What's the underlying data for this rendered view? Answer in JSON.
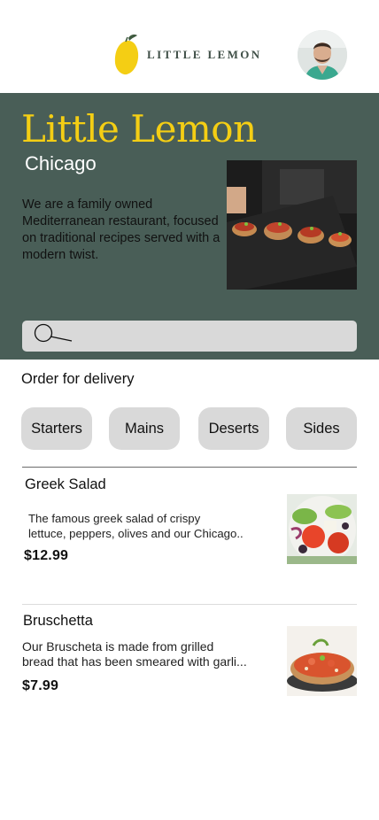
{
  "header": {
    "logo_text": "LITTLE LEMON",
    "logo_icon": "lemon-icon",
    "avatar": "user-avatar"
  },
  "hero": {
    "title": "Little Lemon",
    "city": "Chicago",
    "description": "We are a family owned Mediterranean restaurant, focused on traditional recipes served with a modern twist.",
    "image": "bruschetta-platter-photo",
    "search": {
      "placeholder": "",
      "icon": "search-icon"
    }
  },
  "order": {
    "title": "Order for delivery",
    "categories": [
      "Starters",
      "Mains",
      "Deserts",
      "Sides"
    ]
  },
  "menu": [
    {
      "name": "Greek Salad",
      "description": "The famous greek salad of crispy\nlettuce, peppers, olives and our Chicago..",
      "price": "$12.99",
      "image": "greek-salad-photo"
    },
    {
      "name": "Bruschetta",
      "description": "Our Bruscheta is made from grilled\nbread that has been smeared with garli...",
      "price": "$7.99",
      "image": "bruschetta-photo"
    }
  ],
  "colors": {
    "primary_green": "#495e57",
    "primary_yellow": "#f4ce14",
    "chip_gray": "#d9d9d9"
  }
}
